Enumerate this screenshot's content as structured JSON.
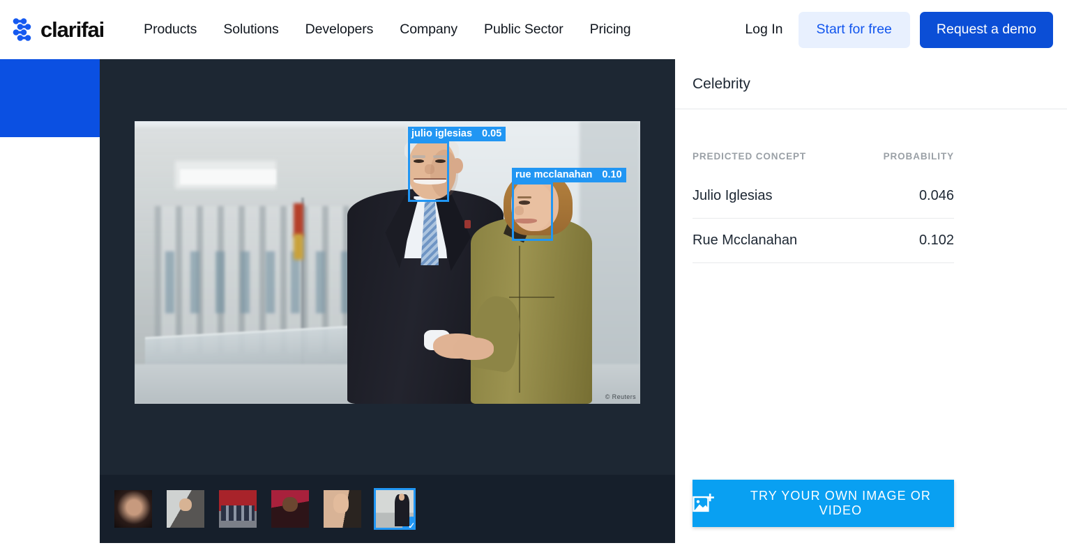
{
  "header": {
    "logo_text": "clarifai",
    "logo_icon": "clarifai-logo-icon",
    "nav": [
      {
        "label": "Products"
      },
      {
        "label": "Solutions"
      },
      {
        "label": "Developers"
      },
      {
        "label": "Company"
      },
      {
        "label": "Public Sector"
      },
      {
        "label": "Pricing"
      }
    ],
    "login_label": "Log In",
    "start_free_label": "Start for free",
    "request_demo_label": "Request a demo",
    "accent_blue": "#0b4ed6",
    "ghost_bg": "#e8f0fe"
  },
  "demo": {
    "image_watermark": "© Reuters",
    "detections": [
      {
        "name": "julio iglesias",
        "score": "0.05"
      },
      {
        "name": "rue mcclanahan",
        "score": "0.10"
      }
    ],
    "box_color": "#2196f3",
    "thumbnails": [
      {
        "alt": "thumbnail-1",
        "selected": false
      },
      {
        "alt": "thumbnail-2",
        "selected": false
      },
      {
        "alt": "thumbnail-3",
        "selected": false
      },
      {
        "alt": "thumbnail-4",
        "selected": false
      },
      {
        "alt": "thumbnail-5",
        "selected": false
      },
      {
        "alt": "thumbnail-6",
        "selected": true
      }
    ],
    "selected_check_icon": "check-icon"
  },
  "results": {
    "model_title": "Celebrity",
    "columns": {
      "concept": "PREDICTED CONCEPT",
      "probability": "PROBABILITY"
    },
    "predictions": [
      {
        "concept": "Julio Iglesias",
        "probability": "0.046"
      },
      {
        "concept": "Rue Mcclanahan",
        "probability": "0.102"
      }
    ],
    "cta_label": "TRY YOUR OWN IMAGE OR VIDEO",
    "cta_icon": "add-image-icon",
    "cta_color": "#09a0f2"
  }
}
